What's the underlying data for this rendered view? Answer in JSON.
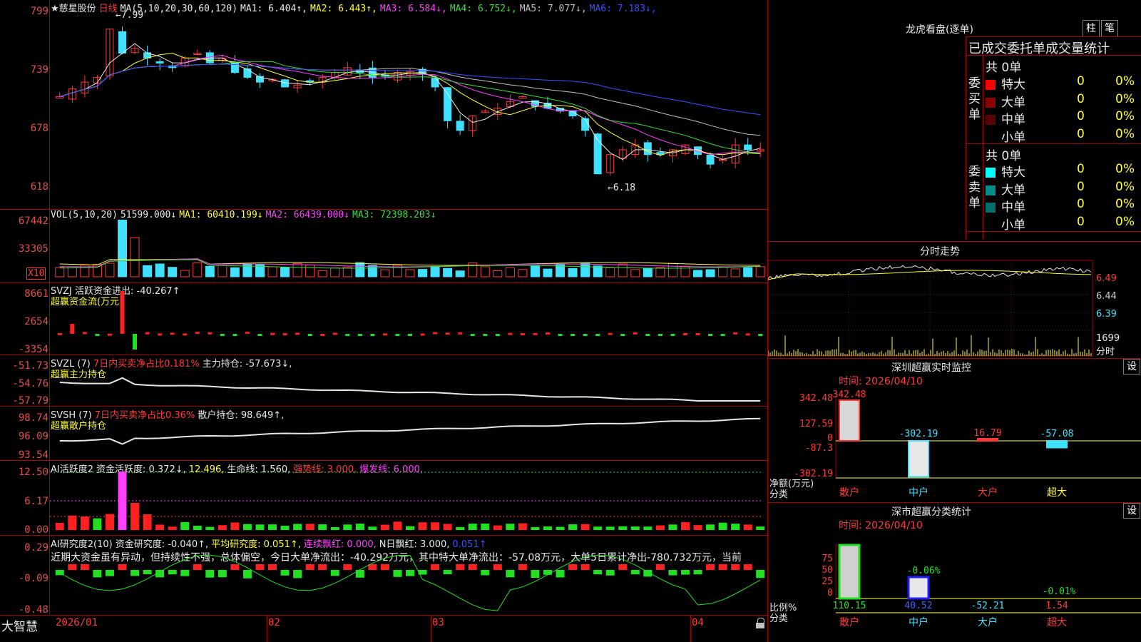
{
  "stock": {
    "name": "★慈星股份",
    "period": "日线",
    "high_mark": "7.99",
    "low_mark": "6.18"
  },
  "kline": {
    "indicator": "MA(5,10,20,30,60,120)",
    "ma": [
      {
        "label": "MA1: 6.404",
        "arrow": "↑",
        "color": "#e8e8e8"
      },
      {
        "label": "MA2: 6.443",
        "arrow": "↑",
        "color": "#ffff3c"
      },
      {
        "label": "MA3: 6.584",
        "arrow": "↓",
        "color": "#ff40ff"
      },
      {
        "label": "MA4: 6.752",
        "arrow": "↓",
        "color": "#3cdc3c"
      },
      {
        "label": "MA5: 7.077",
        "arrow": "↓",
        "color": "#c0c0c0"
      },
      {
        "label": "MA6: 7.183",
        "arrow": "↓",
        "color": "#3a50ff"
      }
    ],
    "yticks": [
      "799",
      "739",
      "678",
      "618"
    ]
  },
  "vol": {
    "header": "VOL(5,10,20)",
    "value": "51599.000↓",
    "ma1": "MA1: 60410.199↓",
    "ma2": "MA2: 66439.000↓",
    "ma3": "MA3: 72398.203↓",
    "yticks": [
      "67442",
      "33305"
    ],
    "unit": "X10"
  },
  "svzj": {
    "header": "SVZJ  活跃资金进出: -40.267↑",
    "sub": "超赢资金流(万元)",
    "yticks": [
      "8661",
      "2654",
      "-3354"
    ]
  },
  "svzl": {
    "header_a": "SVZL (7)",
    "header_b": "7日内买卖净占比0.181%",
    "header_c": "主力持仓: -57.673↓,",
    "sub": "超赢主力持仓",
    "yticks": [
      "-51.73",
      "-54.76",
      "-57.79"
    ]
  },
  "svsh": {
    "header_a": "SVSH (7)",
    "header_b": "7日内买卖净占比0.36%",
    "header_c": "散户持仓: 98.649↑,",
    "sub": "超赢散户持仓",
    "yticks": [
      "98.74",
      "96.09",
      "93.54"
    ]
  },
  "ai": {
    "header_a": "AI活跃度2",
    "header_b": "资金活跃度: 0.372↓,",
    "header_c": "12.496,",
    "header_d": "生命线: 1.560,",
    "header_e": "强势线: 3.000,",
    "header_f": "爆发线: 6.000,",
    "yticks": [
      "12.50",
      "6.17",
      "0.00"
    ]
  },
  "ai_research": {
    "header_a": "AI研究度2(10)",
    "header_b": "资金研究度: -0.040↑,",
    "header_c": "平均研究度: 0.051↑,",
    "header_d": "连续飘红: 0.000,",
    "header_e": "N日飘红: 3.000,",
    "header_f": "0.051↑",
    "comment": "近期大资金虽有异动，但持续性不强，总体偏空，今日大单净流出：-40.292万元，其中特大单净流出：-57.08万元，大单5日累计净出-780.732万元，当前",
    "yticks": [
      "0.29",
      "-0.09",
      "-0.48"
    ]
  },
  "xaxis": {
    "labels": [
      "2026/01",
      "02",
      "03",
      "04"
    ],
    "brand": "大智慧"
  },
  "right": {
    "dragon_title": "龙虎看盘(逐单)",
    "btn1": "柱",
    "btn2": "笔",
    "stats_title": "已成交委托单成交量统计",
    "buy": {
      "side": "委买单",
      "total": "共 0单",
      "rows": [
        {
          "label": "特大",
          "color": "#ff0000",
          "count": "0",
          "pct": "0%"
        },
        {
          "label": "大单",
          "color": "#8c0000",
          "count": "0",
          "pct": "0%"
        },
        {
          "label": "中单",
          "color": "#5a0000",
          "count": "0",
          "pct": "0%"
        },
        {
          "label": "小单",
          "color": "#000000",
          "count": "0",
          "pct": "0%"
        }
      ]
    },
    "sell": {
      "side": "委卖单",
      "total": "共 0单",
      "rows": [
        {
          "label": "特大",
          "color": "#00ffff",
          "count": "0",
          "pct": "0%"
        },
        {
          "label": "大单",
          "color": "#008c8c",
          "count": "0",
          "pct": "0%"
        },
        {
          "label": "中单",
          "color": "#006e6e",
          "count": "0",
          "pct": "0%"
        },
        {
          "label": "小单",
          "color": "#000000",
          "count": "0",
          "pct": "0%"
        }
      ]
    },
    "intraday": {
      "title": "分时走势",
      "yticks": [
        "6.49",
        "6.44",
        "6.39"
      ],
      "vol": "1699",
      "vol_label": "分时"
    },
    "sz_monitor": {
      "title": "深圳超赢实时监控",
      "set": "设",
      "time": "时间: 2026/04/10",
      "yticks": [
        "342.48",
        "127.59",
        "0",
        "-87.3",
        "-302.19"
      ],
      "axis_label_a": "净额(万元)",
      "axis_label_b": "分类",
      "bars": [
        {
          "cat": "散户",
          "value": "342.48",
          "num": 342.48
        },
        {
          "cat": "中户",
          "value": "-302.19",
          "num": -302.19
        },
        {
          "cat": "大户",
          "value": "16.79",
          "num": 16.79
        },
        {
          "cat": "超大",
          "value": "-57.08",
          "num": -57.08
        }
      ]
    },
    "sz_class": {
      "title": "深市超赢分类统计",
      "set": "设",
      "time": "时间: 2026/04/10",
      "yticks": [
        "75",
        "50",
        "25",
        "0"
      ],
      "axis_label_a": "比例%",
      "axis_label_b": "分类",
      "annot1": "-0.06%",
      "annot2": "-0.01%",
      "bars": [
        {
          "cat": "散户",
          "value": "110.15"
        },
        {
          "cat": "中户",
          "value": "40.52"
        },
        {
          "cat": "大户",
          "value": "-52.21"
        },
        {
          "cat": "超大",
          "value": "1.54"
        }
      ]
    }
  },
  "colors": {
    "grid": "#a00000",
    "up": "#ff3a3a",
    "down": "#40e0ff"
  }
}
